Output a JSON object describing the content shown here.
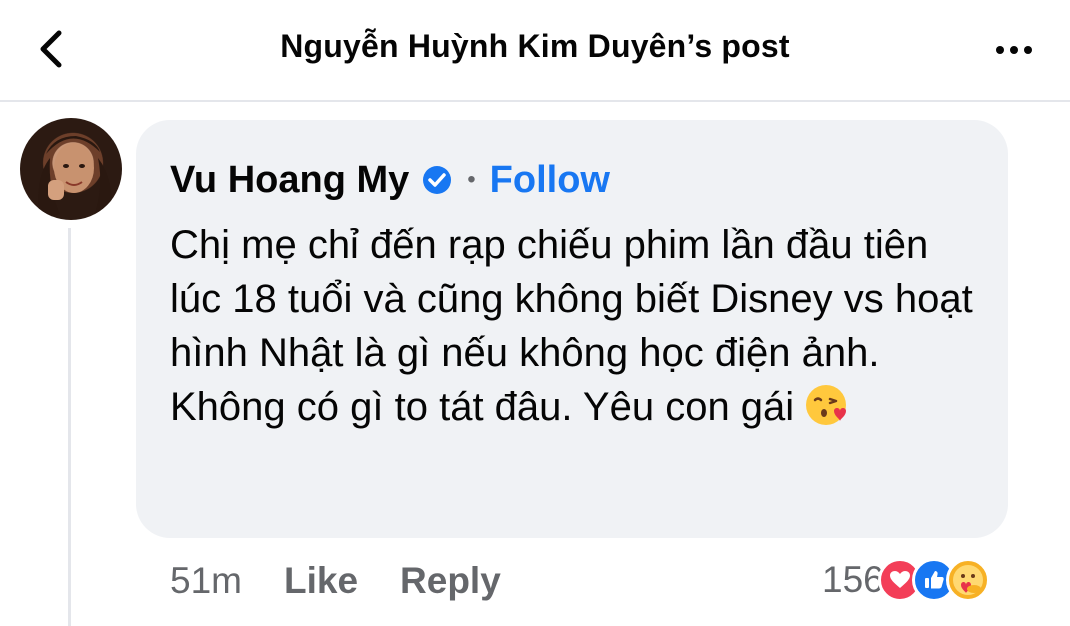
{
  "header": {
    "title": "Nguyễn Huỳnh Kim Duyên’s post"
  },
  "comment": {
    "author": "Vu Hoang My",
    "separator": "•",
    "follow_label": "Follow",
    "text": "Chị mẹ chỉ đến rạp chiếu phim lần đầu tiên lúc 18 tuổi và cũng không biết Disney vs hoạt hình Nhật là gì nếu không học điện ảnh. Không có gì to tát đâu. Yêu con gái",
    "emoji": "face-blowing-kiss-icon",
    "time": "51m",
    "like_label": "Like",
    "reply_label": "Reply",
    "reaction_count": "156",
    "reactions": [
      "love-reaction-icon",
      "like-reaction-icon",
      "care-reaction-icon"
    ]
  },
  "colors": {
    "accent": "#1877f2",
    "bubble": "#f0f2f5",
    "secondary_text": "#65676b",
    "love": "#f33e58",
    "care": "#f7b125"
  }
}
